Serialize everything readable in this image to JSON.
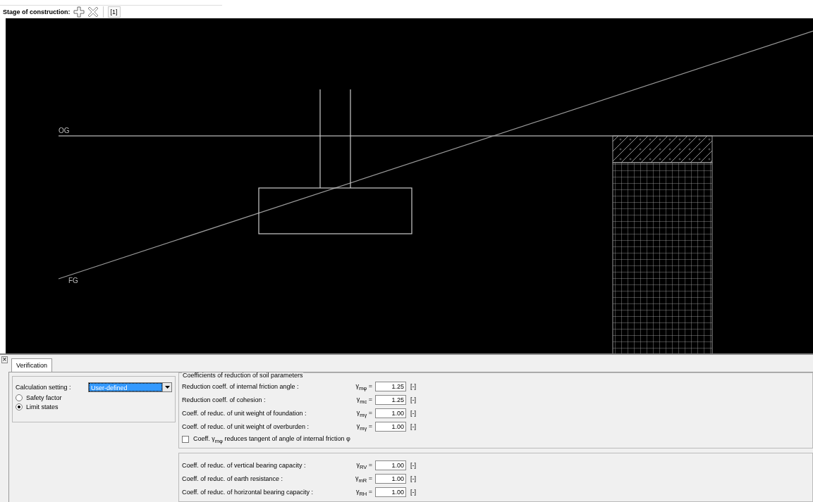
{
  "toolbar": {
    "label": "Stage of construction:",
    "stages": [
      {
        "label": "[1]",
        "selected": true
      }
    ]
  },
  "canvas": {
    "labels": [
      {
        "text": "OG",
        "kind": "original"
      },
      {
        "text": "FG",
        "kind": "finished"
      }
    ]
  },
  "panel": {
    "close": "×",
    "tabs": [
      {
        "label": "Verification",
        "selected": true
      }
    ],
    "setting": {
      "label": "Calculation setting :",
      "value": "User-defined"
    },
    "options": [
      {
        "label": "Safety factor",
        "selected": false
      },
      {
        "label": "Limit states",
        "selected": true
      }
    ],
    "soil_group": {
      "title": "Coefficients of reduction of soil parameters",
      "rows": [
        {
          "label": "Reduction coeff. of internal friction angle :",
          "symbol": "γ$_{mφ}$ =",
          "value": "1.25",
          "unit": "[-]"
        },
        {
          "label": "Reduction coeff. of cohesion :",
          "symbol": "γ$_{mc}$ =",
          "value": "1.25",
          "unit": "[-]"
        },
        {
          "label": "Coeff. of reduc. of unit weight of foundation :",
          "symbol": "γ$_{mγ}$ =",
          "value": "1.00",
          "unit": "[-]"
        },
        {
          "label": "Coeff. of reduc. of unit weight of overburden :",
          "symbol": "γ$_{mγ}$ =",
          "value": "1.00",
          "unit": "[-]"
        }
      ],
      "checkbox": {
        "label": "Coeff. γ$_{mφ}$ reduces tangent of angle of internal friction φ",
        "checked": false
      }
    },
    "bearing_rows": [
      {
        "label": "Coeff. of reduc. of vertical bearing capacity :",
        "symbol": "γ$_{RV}$ =",
        "value": "1.00",
        "unit": "[-]"
      },
      {
        "label": "Coeff. of reduc. of earth resistance :",
        "symbol": "γ$_{mR}$ =",
        "value": "1.00",
        "unit": "[-]"
      },
      {
        "label": "Coeff. of reduc. of horizontal bearing capacity :",
        "symbol": "γ$_{RH}$ =",
        "value": "1.00",
        "unit": "[-]"
      }
    ]
  }
}
